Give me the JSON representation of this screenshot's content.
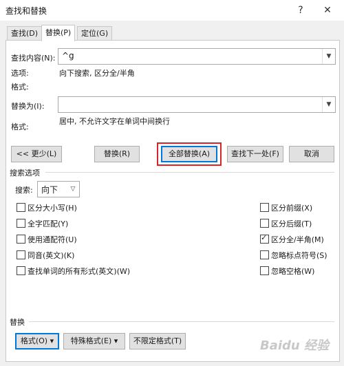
{
  "window": {
    "title": "查找和替换",
    "help": "?",
    "close": "✕"
  },
  "tabs": [
    {
      "label": "查找(D)"
    },
    {
      "label": "替换(P)"
    },
    {
      "label": "定位(G)"
    }
  ],
  "find": {
    "label": "查找内容(N):",
    "value": "^g",
    "options_label": "选项:",
    "options_value": "向下搜索, 区分全/半角",
    "format_label": "格式:"
  },
  "replace": {
    "label": "替换为(I):",
    "value": "",
    "format_label": "格式:",
    "format_value": "居中, 不允许文字在单词中间换行"
  },
  "buttons": {
    "less": "<< 更少(L)",
    "replace": "替换(R)",
    "replace_all": "全部替换(A)",
    "find_next": "查找下一处(F)",
    "cancel": "取消"
  },
  "search": {
    "section_title": "搜索选项",
    "label": "搜索:",
    "value": "向下"
  },
  "options_left": [
    {
      "label": "区分大小写(H)",
      "checked": false
    },
    {
      "label": "全字匹配(Y)",
      "checked": false
    },
    {
      "label": "使用通配符(U)",
      "checked": false
    },
    {
      "label": "同音(英文)(K)",
      "checked": false
    },
    {
      "label": "查找单词的所有形式(英文)(W)",
      "checked": false
    }
  ],
  "options_right": [
    {
      "label": "区分前缀(X)",
      "checked": false
    },
    {
      "label": "区分后缀(T)",
      "checked": false
    },
    {
      "label": "区分全/半角(M)",
      "checked": true
    },
    {
      "label": "忽略标点符号(S)",
      "checked": false
    },
    {
      "label": "忽略空格(W)",
      "checked": false
    }
  ],
  "replace_section": {
    "title": "替换",
    "format_btn": "格式(O) ▾",
    "special_btn": "特殊格式(E) ▾",
    "no_format_btn": "不限定格式(T)"
  },
  "watermark": "Baidu 经验"
}
